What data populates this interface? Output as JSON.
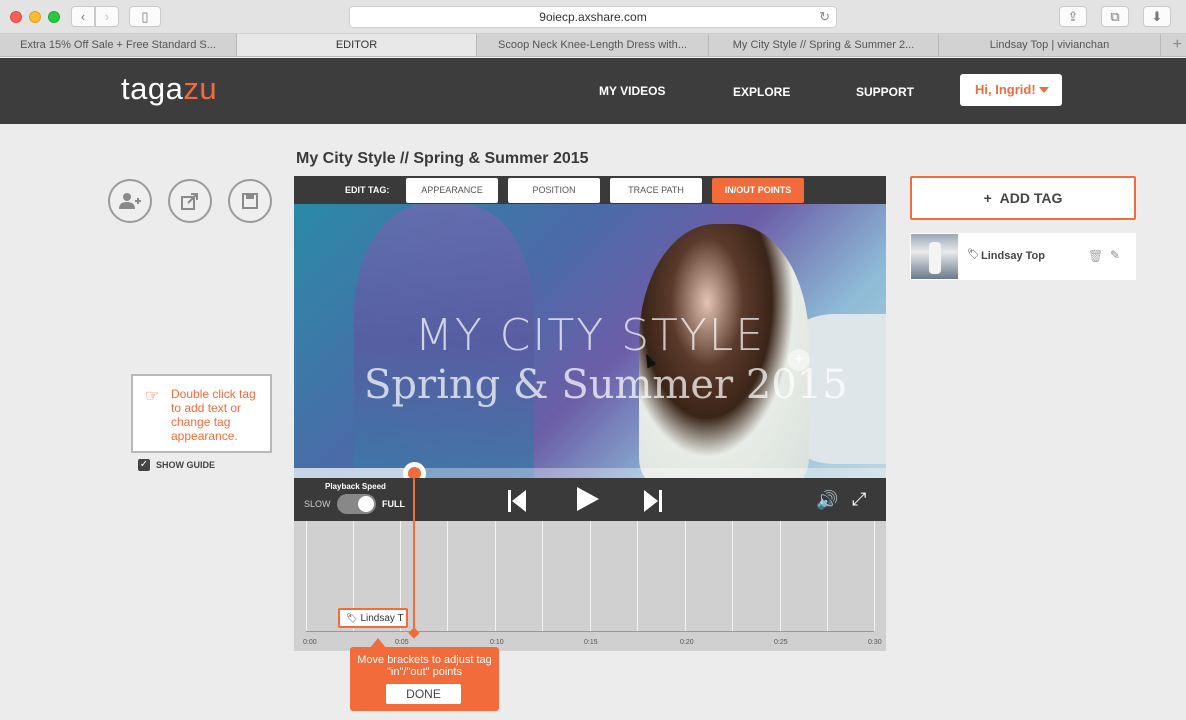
{
  "browser": {
    "url": "9oiecp.axshare.com",
    "tabs": [
      {
        "label": "Extra 15% Off Sale + Free Standard S..."
      },
      {
        "label": "EDITOR"
      },
      {
        "label": "Scoop Neck Knee-Length Dress with..."
      },
      {
        "label": "My City Style // Spring & Summer 2..."
      },
      {
        "label": "Lindsay Top | vivianchan"
      }
    ]
  },
  "header": {
    "logo_main": "taga",
    "logo_accent": "zu",
    "nav": [
      "MY VIDEOS",
      "EXPLORE",
      "SUPPORT"
    ],
    "user_greeting": "Hi, Ingrid!"
  },
  "guide": {
    "text": "Double click tag to add text or change tag appearance.",
    "show_label": "SHOW GUIDE"
  },
  "editor": {
    "title": "My City Style // Spring & Summer 2015",
    "edit_label": "EDIT TAG:",
    "edit_buttons": [
      "APPEARANCE",
      "POSITION",
      "TRACE PATH",
      "IN/OUT POINTS"
    ],
    "video_title_1": "MY CITY STYLE",
    "video_title_2": "Spring & Summer 2015",
    "playback_speed_label": "Playback Speed",
    "slow_label": "SLOW",
    "full_label": "FULL",
    "progress": 0.2
  },
  "timeline": {
    "ticks": [
      "0:00",
      "0:05",
      "0:10",
      "0:15",
      "0:20",
      "0:25",
      "0:30"
    ],
    "tag_label": "Lindsay T",
    "tooltip_text": "Move brackets to adjust tag \"in\"/\"out\" points",
    "done_label": "DONE"
  },
  "panel": {
    "add_tag_label": "ADD TAG",
    "tags": [
      {
        "name": "Lindsay Top"
      }
    ]
  },
  "colors": {
    "accent": "#f26b3a",
    "header_bg": "#3d3d3d"
  }
}
